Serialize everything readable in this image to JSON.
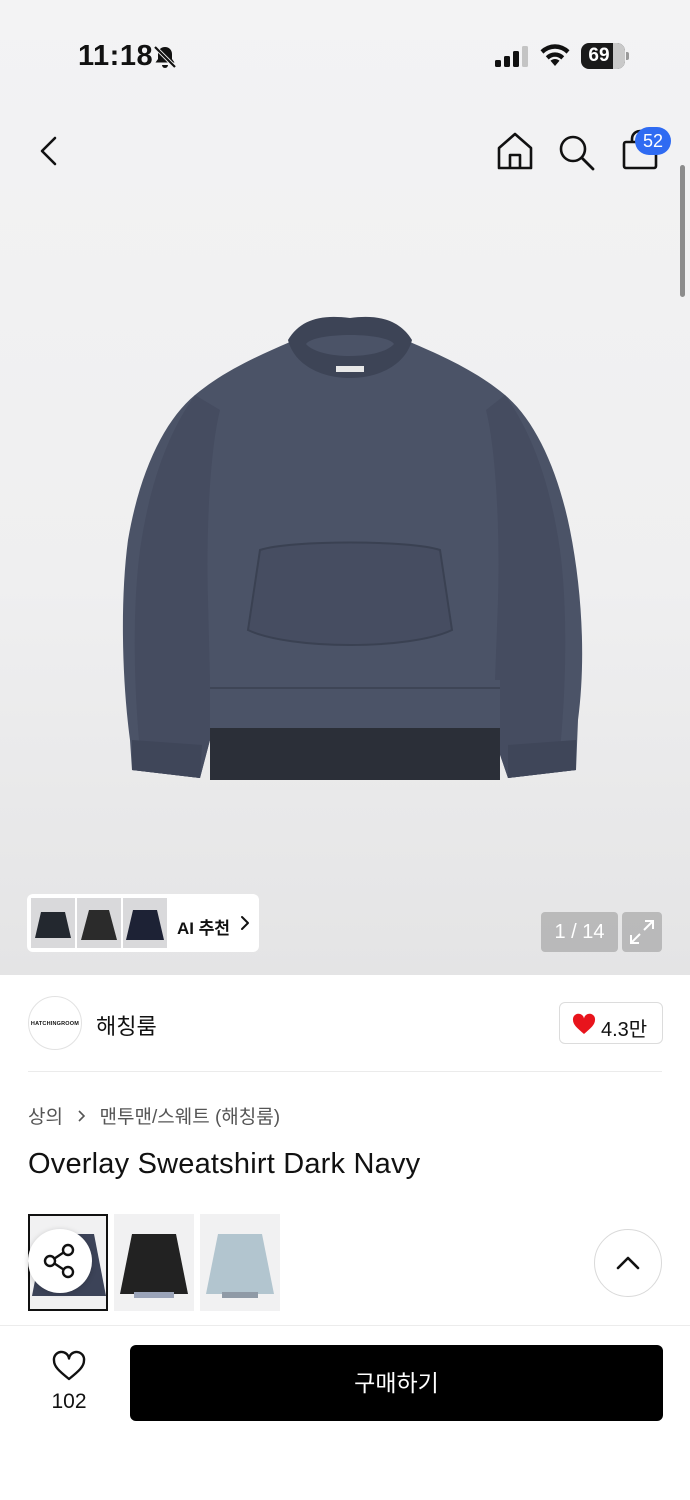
{
  "status_bar": {
    "time": "11:18",
    "battery": "69",
    "icons": [
      "bell-off-icon",
      "signal-icon",
      "wifi-icon",
      "battery-icon"
    ]
  },
  "nav": {
    "icons": [
      "back-icon",
      "home-icon",
      "search-icon",
      "shopping-bag-icon"
    ],
    "cart_count": "52"
  },
  "gallery": {
    "current": "1",
    "total": "14",
    "counter": "1 / 14",
    "ai_recommend_label": "AI 추천",
    "product_color": "#4b5367"
  },
  "brand": {
    "logo_text": "HATCHINGROOM",
    "name": "해칭룸",
    "likes": "4.3만"
  },
  "product": {
    "breadcrumb": [
      "상의",
      "맨투맨/스웨트 (해칭룸)"
    ],
    "title": "Overlay Sweatshirt Dark Navy",
    "colors": [
      {
        "name": "dark-navy",
        "hex": "#3c4358",
        "selected": true
      },
      {
        "name": "black",
        "hex": "#222222",
        "selected": false
      },
      {
        "name": "light-blue",
        "hex": "#b2c5cf",
        "selected": false
      }
    ]
  },
  "bottom_bar": {
    "wish_count": "102",
    "buy_label": "구매하기"
  },
  "colors": {
    "badge": "#2f6bf2",
    "heart": "#e8141c",
    "buy_button": "#000000"
  }
}
